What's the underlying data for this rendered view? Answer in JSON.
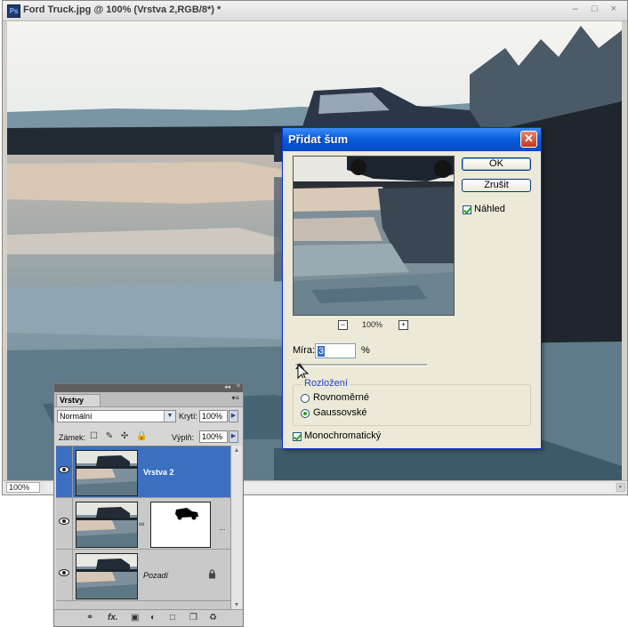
{
  "document": {
    "title": "Ford Truck.jpg @ 100% (Vrstva 2,RGB/8*) *",
    "app_icon": "Ps",
    "window_controls": "– □ ×",
    "zoom": "100%"
  },
  "dialog": {
    "title": "Přidat šum",
    "ok_label": "OK",
    "cancel_label": "Zrušit",
    "preview_label": "Náhled",
    "preview_checked": true,
    "preview_zoom": "100%",
    "zoom_minus": "−",
    "zoom_plus": "+",
    "amount_label": "Míra:",
    "amount_value": "3",
    "amount_unit": "%",
    "distribution_label": "Rozložení",
    "uniform_label": "Rovnoměrné",
    "gaussian_label": "Gaussovské",
    "selected_distribution": "Gaussovské",
    "monochromatic_label": "Monochromatický",
    "monochromatic_checked": true
  },
  "layers_panel": {
    "tab_label": "Vrstvy",
    "collapse_icon": "◂◂",
    "close_icon": "×",
    "menu_icon": "▾≡",
    "blend_mode": "Normální",
    "opacity_label": "Krytí:",
    "opacity_value": "100%",
    "fill_label": "Výplň:",
    "fill_value": "100%",
    "lock_label": "Zámek:",
    "lock_icons": "☐ ✎ ✣ 🔒",
    "layers": [
      {
        "name": "Vrstva 2",
        "selected": true
      },
      {
        "name": "",
        "has_mask": true,
        "dots": "..."
      },
      {
        "name": "Pozadí",
        "locked": true
      }
    ],
    "bottom_icons": [
      "link-layers-icon",
      "fx-icon",
      "add-mask-icon",
      "adjustment-layer-icon",
      "new-group-icon",
      "new-layer-icon",
      "delete-layer-icon"
    ],
    "fx_text": "fx."
  }
}
